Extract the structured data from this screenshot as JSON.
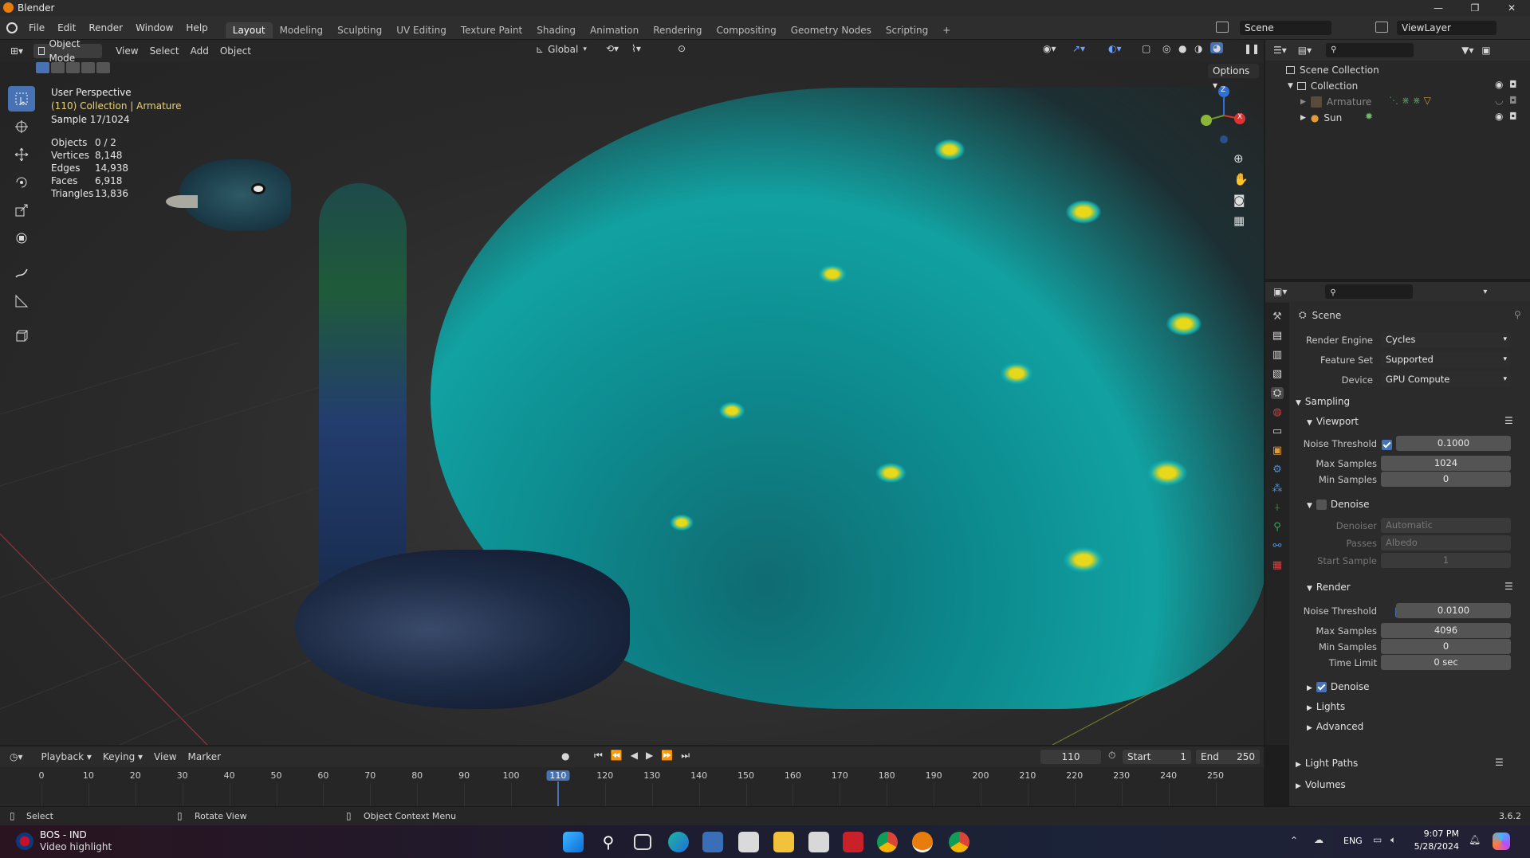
{
  "window": {
    "title": "Blender",
    "controls": [
      "—",
      "❐",
      "✕"
    ]
  },
  "menu": {
    "items": [
      "File",
      "Edit",
      "Render",
      "Window",
      "Help"
    ],
    "workspaces": [
      "Layout",
      "Modeling",
      "Sculpting",
      "UV Editing",
      "Texture Paint",
      "Shading",
      "Animation",
      "Rendering",
      "Compositing",
      "Geometry Nodes",
      "Scripting"
    ],
    "active_workspace": "Layout",
    "add": "+",
    "scene": "Scene",
    "view_layer": "ViewLayer"
  },
  "viewport": {
    "mode": "Object Mode",
    "menus": [
      "View",
      "Select",
      "Add",
      "Object"
    ],
    "transform_orientation": "Global",
    "options": "Options",
    "overlay_title": "User Perspective",
    "overlay_collection": "(110) Collection | Armature",
    "overlay_sample": "Sample 17/1024",
    "stats": [
      {
        "k": "Objects",
        "v": "0 / 2"
      },
      {
        "k": "Vertices",
        "v": "8,148"
      },
      {
        "k": "Edges",
        "v": "14,938"
      },
      {
        "k": "Faces",
        "v": "6,918"
      },
      {
        "k": "Triangles",
        "v": "13,836"
      }
    ],
    "gizmo": {
      "z": "Z",
      "x": "X"
    }
  },
  "outliner": {
    "root": "Scene Collection",
    "collection": "Collection",
    "items": [
      "Armature",
      "Sun"
    ]
  },
  "properties": {
    "context": "Scene",
    "render_engine_label": "Render Engine",
    "render_engine": "Cycles",
    "feature_set_label": "Feature Set",
    "feature_set": "Supported",
    "device_label": "Device",
    "device": "GPU Compute",
    "sampling": "Sampling",
    "viewport": "Viewport",
    "noise_threshold_label": "Noise Threshold",
    "vp_noise": "0.1000",
    "max_samples_label": "Max Samples",
    "vp_max": "1024",
    "min_samples_label": "Min Samples",
    "vp_min": "0",
    "denoise": "Denoise",
    "denoiser_label": "Denoiser",
    "denoiser": "Automatic",
    "passes_label": "Passes",
    "passes": "Albedo",
    "start_sample_label": "Start Sample",
    "start_sample": "1",
    "render": "Render",
    "r_noise": "0.0100",
    "r_max": "4096",
    "r_min": "0",
    "time_limit_label": "Time Limit",
    "time_limit": "0 sec",
    "r_denoise": "Denoise",
    "lights": "Lights",
    "advanced": "Advanced",
    "light_paths": "Light Paths",
    "volumes": "Volumes"
  },
  "timeline": {
    "menus": [
      "Playback",
      "Keying",
      "View",
      "Marker"
    ],
    "current_frame": "110",
    "start_label": "Start",
    "start": "1",
    "end_label": "End",
    "end": "250",
    "ticks": [
      "0",
      "10",
      "20",
      "30",
      "40",
      "50",
      "60",
      "70",
      "80",
      "90",
      "100",
      "110",
      "120",
      "130",
      "140",
      "150",
      "160",
      "170",
      "180",
      "190",
      "200",
      "210",
      "220",
      "230",
      "240",
      "250"
    ]
  },
  "status": {
    "select": "Select",
    "rotate": "Rotate View",
    "context_menu": "Object Context Menu",
    "version": "3.6.2"
  },
  "taskbar": {
    "news_title": "BOS - IND",
    "news_sub": "Video highlight",
    "lang": "ENG",
    "time": "9:07 PM",
    "date": "5/28/2024"
  }
}
